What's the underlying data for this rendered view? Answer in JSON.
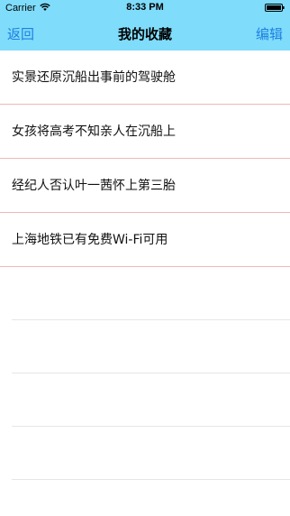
{
  "status_bar": {
    "carrier": "Carrier",
    "time": "8:33 PM",
    "icons": [
      "wifi-icon",
      "battery-icon"
    ]
  },
  "nav": {
    "back_label": "返回",
    "title": "我的收藏",
    "edit_label": "编辑"
  },
  "colors": {
    "header_bg": "#7fdcfb",
    "nav_button": "#1f7fe0",
    "row_separator": "#f0b8b8",
    "empty_separator": "#e6e6e6"
  },
  "favorites": [
    {
      "title": "实景还原沉船出事前的驾驶舱"
    },
    {
      "title": "女孩将高考不知亲人在沉船上"
    },
    {
      "title": "经纪人否认叶一茜怀上第三胎"
    },
    {
      "title": "上海地铁已有免费Wi-Fi可用"
    }
  ]
}
